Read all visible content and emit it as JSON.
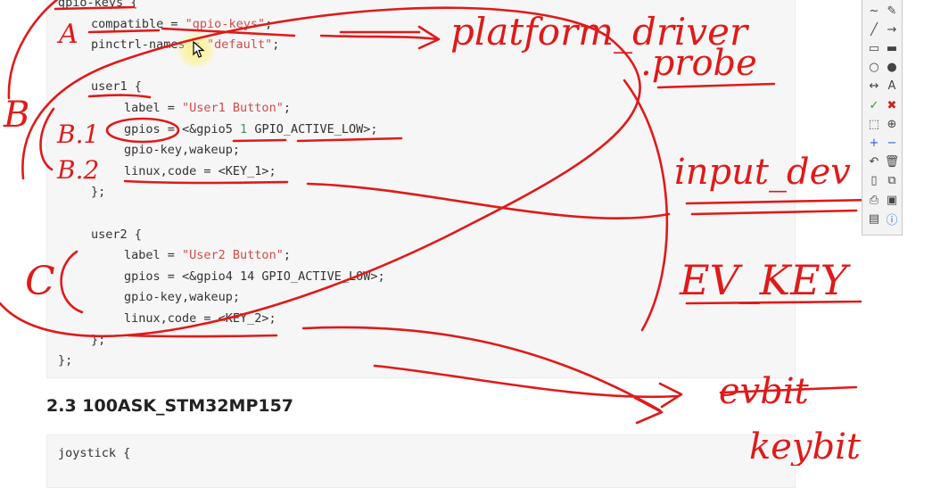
{
  "code_block_1": {
    "lines": [
      {
        "indent": 0,
        "parts": [
          {
            "t": "gpio-keys {"
          }
        ]
      },
      {
        "indent": 1,
        "parts": [
          {
            "t": "compatible = "
          },
          {
            "t": "\"gpio-keys\"",
            "c": "str"
          },
          {
            "t": ";"
          }
        ]
      },
      {
        "indent": 1,
        "parts": [
          {
            "t": "pinctrl-names = "
          },
          {
            "t": "\"default\"",
            "c": "str"
          },
          {
            "t": ";"
          }
        ]
      },
      {
        "indent": 0,
        "parts": [
          {
            "t": ""
          }
        ]
      },
      {
        "indent": 1,
        "parts": [
          {
            "t": "user1 {"
          }
        ]
      },
      {
        "indent": 2,
        "parts": [
          {
            "t": "label = "
          },
          {
            "t": "\"User1 Button\"",
            "c": "str"
          },
          {
            "t": ";"
          }
        ]
      },
      {
        "indent": 2,
        "parts": [
          {
            "t": "gpios = <&gpio5 "
          },
          {
            "t": "1",
            "c": "num"
          },
          {
            "t": " GPIO_ACTIVE_LOW>;"
          }
        ]
      },
      {
        "indent": 2,
        "parts": [
          {
            "t": "gpio-key,wakeup;"
          }
        ]
      },
      {
        "indent": 2,
        "parts": [
          {
            "t": "linux,code = <KEY_1>;"
          }
        ]
      },
      {
        "indent": 1,
        "parts": [
          {
            "t": "};"
          }
        ]
      },
      {
        "indent": 0,
        "parts": [
          {
            "t": ""
          }
        ]
      },
      {
        "indent": 1,
        "parts": [
          {
            "t": "user2 {"
          }
        ]
      },
      {
        "indent": 2,
        "parts": [
          {
            "t": "label = "
          },
          {
            "t": "\"User2 Button\"",
            "c": "str"
          },
          {
            "t": ";"
          }
        ]
      },
      {
        "indent": 2,
        "parts": [
          {
            "t": "gpios = <&gpio4 14 GPIO_ACTIVE_LOW>;"
          }
        ]
      },
      {
        "indent": 2,
        "parts": [
          {
            "t": "gpio-key,wakeup;"
          }
        ]
      },
      {
        "indent": 2,
        "parts": [
          {
            "t": "linux,code = <KEY_2>;"
          }
        ]
      },
      {
        "indent": 1,
        "parts": [
          {
            "t": "};"
          }
        ]
      },
      {
        "indent": 0,
        "parts": [
          {
            "t": "};"
          }
        ]
      }
    ]
  },
  "section_heading": "2.3 100ASK_STM32MP157",
  "code_block_2": {
    "lines": [
      {
        "indent": 0,
        "parts": [
          {
            "t": "joystick {"
          }
        ]
      }
    ]
  },
  "annotations": {
    "labels": [
      "A",
      "B",
      "B.1",
      "B.2",
      "C"
    ],
    "notes": [
      "platform_driver",
      ".probe",
      "input_dev",
      "EV_KEY",
      "evbit",
      "keybit"
    ]
  },
  "toolbox": {
    "tools": [
      "curve-pen-icon",
      "eraser-icon",
      "line-icon",
      "arrow-line-icon",
      "rectangle-outline-icon",
      "rectangle-filled-icon",
      "ellipse-outline-icon",
      "ellipse-filled-icon",
      "double-arrow-icon",
      "text-tool-icon",
      "check-icon",
      "delete-x-icon",
      "select-region-icon",
      "zoom-in-icon",
      "plus-icon",
      "minus-icon",
      "undo-icon",
      "trash-icon",
      "new-page-icon",
      "copy-icon",
      "print-icon",
      "save-icon",
      "screenshot-icon",
      "info-icon"
    ]
  },
  "colors": {
    "ink": "#e01a1a",
    "code_background": "#f6f6f6",
    "string": "#d14b4b",
    "number": "#3a9a5a"
  }
}
